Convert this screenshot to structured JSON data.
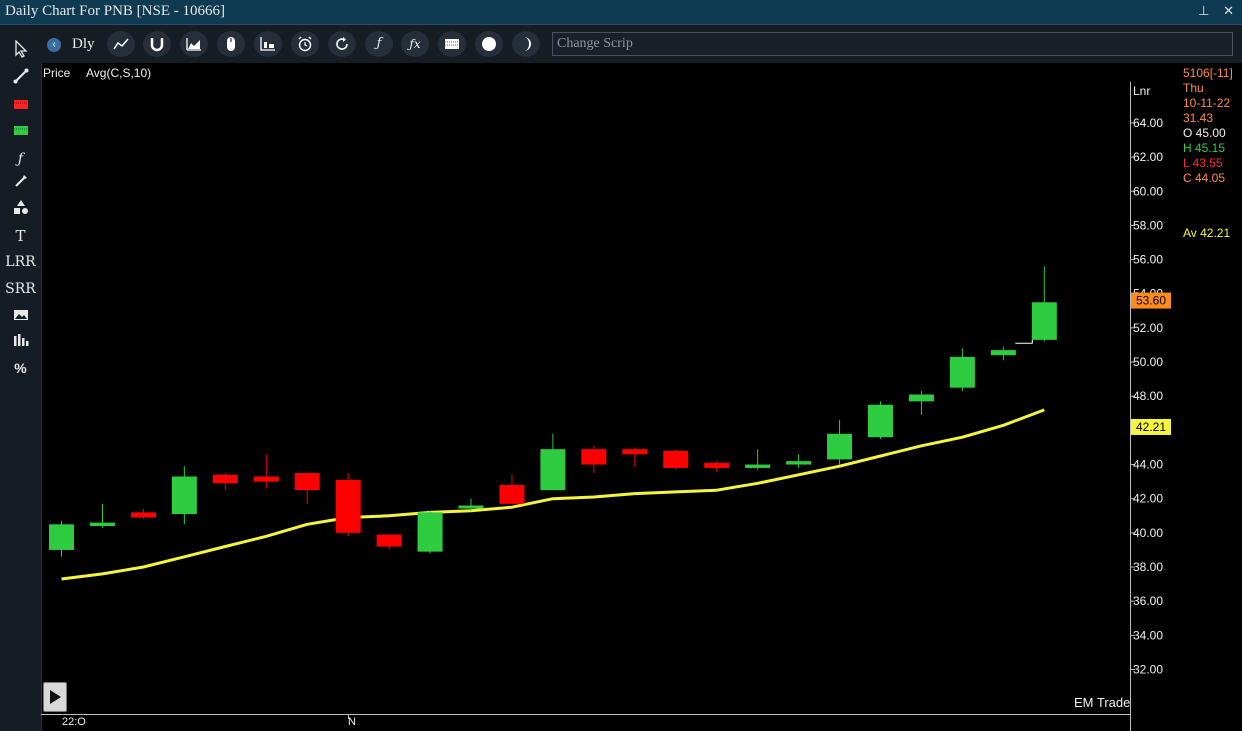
{
  "window": {
    "title": "Daily Chart For PNB [NSE - 10666]",
    "pin_icon": "pin-icon",
    "close_icon": "close-icon"
  },
  "toolbar": {
    "back_icon": "chevron-left-icon",
    "interval_label": "Dly",
    "buttons": [
      "line-chart-icon",
      "magnet-icon",
      "area-chart-icon",
      "mouse-icon",
      "bar-settings-icon",
      "alarm-clock-icon",
      "refresh-icon",
      "function-icon",
      "formula-icon",
      "grid-icon",
      "circle-icon",
      "moon-icon"
    ],
    "search_placeholder": "Change Scrip"
  },
  "sidebar": {
    "tools": [
      {
        "name": "pointer-tool",
        "label": "",
        "icon": "cursor-icon"
      },
      {
        "name": "trendline-tool",
        "label": "",
        "icon": "trendline-icon"
      },
      {
        "name": "red-bars-tool",
        "label": "",
        "icon": "red-bars-icon"
      },
      {
        "name": "green-bars-tool",
        "label": "",
        "icon": "green-bars-icon"
      },
      {
        "name": "function-tool",
        "label": "ƒ",
        "icon": "function-icon"
      },
      {
        "name": "brush-tool",
        "label": "",
        "icon": "brush-icon"
      },
      {
        "name": "shapes-tool",
        "label": "",
        "icon": "shapes-icon"
      },
      {
        "name": "text-tool",
        "label": "T",
        "icon": "text-icon"
      },
      {
        "name": "lrr-tool",
        "label": "LRR",
        "icon": ""
      },
      {
        "name": "srr-tool",
        "label": "SRR",
        "icon": ""
      },
      {
        "name": "image-tool",
        "label": "",
        "icon": "image-icon"
      },
      {
        "name": "histogram-tool",
        "label": "",
        "icon": "histogram-icon"
      },
      {
        "name": "percent-tool",
        "label": "%",
        "icon": "percent-icon"
      }
    ]
  },
  "legend": {
    "price": "Price",
    "indicator": "Avg(C,S,10)"
  },
  "info_panel": {
    "bar": "5106[-11]",
    "day": "Thu",
    "date": "10-11-22",
    "val": "31.43",
    "open": "O 45.00",
    "high": "H 45.15",
    "low": "L 43.55",
    "close": "C 44.05",
    "avg": "Av 42.21"
  },
  "axis": {
    "scale_label": "Lnr",
    "last_price_label": "53.60",
    "avg_label": "42.21"
  },
  "watermark": "EM Trade",
  "colors": {
    "up": "#2ecc40",
    "down": "#ff0000",
    "avg_line": "#f5f53c",
    "titlebar": "#0e3a52"
  },
  "chart_data": {
    "type": "candlestick",
    "scale": "linear",
    "ylim": [
      31,
      66
    ],
    "yticks": [
      "64.00",
      "62.00",
      "60.00",
      "58.00",
      "56.00",
      "54.00",
      "52.00",
      "50.00",
      "48.00",
      "46.00",
      "44.00",
      "42.00",
      "40.00",
      "38.00",
      "36.00",
      "34.00",
      "32.00"
    ],
    "xticks": [
      "22:O",
      "N"
    ],
    "grid": false,
    "candles": [
      {
        "o": 39.0,
        "h": 40.7,
        "l": 38.6,
        "c": 40.5
      },
      {
        "o": 40.4,
        "h": 41.7,
        "l": 40.3,
        "c": 40.6
      },
      {
        "o": 41.2,
        "h": 41.4,
        "l": 40.8,
        "c": 40.9
      },
      {
        "o": 41.1,
        "h": 43.9,
        "l": 40.5,
        "c": 43.3
      },
      {
        "o": 43.4,
        "h": 43.5,
        "l": 42.5,
        "c": 42.9
      },
      {
        "o": 43.3,
        "h": 44.6,
        "l": 42.6,
        "c": 43.0
      },
      {
        "o": 43.5,
        "h": 43.6,
        "l": 41.7,
        "c": 42.5
      },
      {
        "o": 43.1,
        "h": 43.5,
        "l": 39.8,
        "c": 40.0
      },
      {
        "o": 39.9,
        "h": 39.9,
        "l": 39.0,
        "c": 39.2
      },
      {
        "o": 38.9,
        "h": 41.3,
        "l": 38.8,
        "c": 41.2
      },
      {
        "o": 41.5,
        "h": 42.0,
        "l": 41.3,
        "c": 41.6
      },
      {
        "o": 42.8,
        "h": 43.4,
        "l": 41.7,
        "c": 41.7
      },
      {
        "o": 42.5,
        "h": 45.8,
        "l": 42.5,
        "c": 44.9
      },
      {
        "o": 44.9,
        "h": 45.1,
        "l": 43.5,
        "c": 44.0
      },
      {
        "o": 44.9,
        "h": 45.0,
        "l": 43.9,
        "c": 44.6
      },
      {
        "o": 44.8,
        "h": 44.9,
        "l": 43.7,
        "c": 43.8
      },
      {
        "o": 44.1,
        "h": 44.2,
        "l": 43.6,
        "c": 43.8
      },
      {
        "o": 43.8,
        "h": 44.9,
        "l": 43.7,
        "c": 44.0
      },
      {
        "o": 44.0,
        "h": 44.6,
        "l": 43.8,
        "c": 44.2
      },
      {
        "o": 44.3,
        "h": 46.6,
        "l": 44.0,
        "c": 45.8
      },
      {
        "o": 45.6,
        "h": 47.7,
        "l": 45.5,
        "c": 47.5
      },
      {
        "o": 47.7,
        "h": 48.3,
        "l": 46.9,
        "c": 48.1
      },
      {
        "o": 48.5,
        "h": 50.8,
        "l": 48.3,
        "c": 50.3
      },
      {
        "o": 50.4,
        "h": 50.9,
        "l": 50.1,
        "c": 50.7
      },
      {
        "o": 51.3,
        "h": 55.6,
        "l": 51.2,
        "c": 53.5
      }
    ],
    "average_series": {
      "name": "Avg(C,S,10)",
      "values": [
        37.3,
        37.6,
        38.0,
        38.6,
        39.2,
        39.8,
        40.5,
        40.9,
        41.0,
        41.2,
        41.3,
        41.5,
        42.0,
        42.1,
        42.3,
        42.4,
        42.5,
        42.9,
        43.4,
        43.9,
        44.5,
        45.1,
        45.6,
        46.3,
        47.2
      ]
    }
  }
}
